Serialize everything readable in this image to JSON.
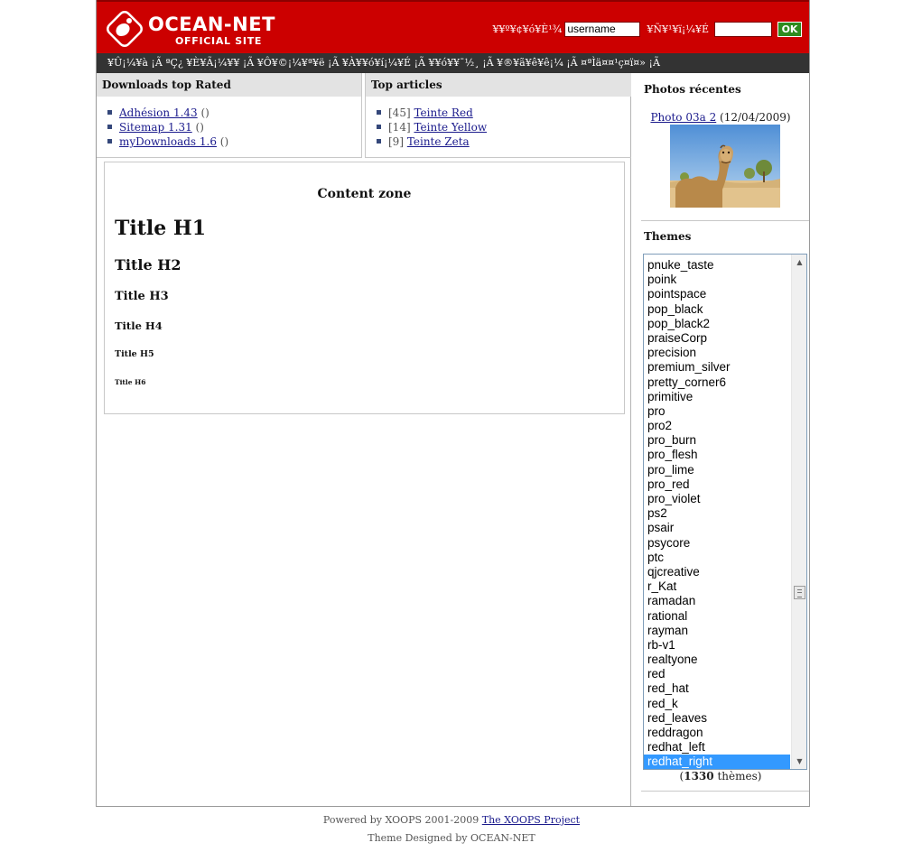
{
  "header": {
    "brand": "OCEAN-NET",
    "subtitle": "OFFICIAL SITE",
    "login": {
      "user_label": "¥¥º¥¢¥ó¥È¹¾",
      "user_value": "username",
      "pass_label": "¥Ñ¥¹¥ï¡¼¥É",
      "pass_value": "",
      "ok_label": "OK"
    },
    "colors": {
      "header_bg": "#cc0000",
      "nav_bg": "#333333",
      "ok_bg": "#2e8b1e"
    }
  },
  "nav": {
    "text": "¥Û¡¼¥à ¡Ã ªÇ¿ ¥È¥Ã¡¼¥¥ ¡Ã ¥Ô¥©¡¼¥ª¥ë ¡Ã ¥À¥¥ó¥í¡¼¥É ¡Ã ¥¥ó¥¥¯½¸ ¡Ã ¥®¥ã¥ê¥ê¡¼ ¡Ã ¤ªÌä¤¤¹ç¤ï¤» ¡Ã"
  },
  "downloads_block": {
    "title": "Downloads top Rated",
    "items": [
      {
        "label": "Adhésion 1.43",
        "suffix": " ()"
      },
      {
        "label": "Sitemap 1.31",
        "suffix": " ()"
      },
      {
        "label": "myDownloads 1.6",
        "suffix": " ()"
      }
    ]
  },
  "articles_block": {
    "title": "Top articles",
    "items": [
      {
        "prefix": "[45] ",
        "label": "Teinte Red"
      },
      {
        "prefix": "[14] ",
        "label": "Teinte Yellow"
      },
      {
        "prefix": "[9] ",
        "label": "Teinte Zeta"
      }
    ]
  },
  "content": {
    "zone_title": "Content zone",
    "h1": "Title H1",
    "h2": "Title H2",
    "h3": "Title H3",
    "h4": "Title H4",
    "h5": "Title H5",
    "h6": "Title H6"
  },
  "photos": {
    "title": "Photos récentes",
    "link": "Photo 03a 2",
    "date": " (12/04/2009)",
    "image_subject": "camel-photo"
  },
  "themes": {
    "title": "Themes",
    "options": [
      "pnuke_taste",
      "poink",
      "pointspace",
      "pop_black",
      "pop_black2",
      "praiseCorp",
      "precision",
      "premium_silver",
      "pretty_corner6",
      "primitive",
      "pro",
      "pro2",
      "pro_burn",
      "pro_flesh",
      "pro_lime",
      "pro_red",
      "pro_violet",
      "ps2",
      "psair",
      "psycore",
      "ptc",
      "qjcreative",
      "r_Kat",
      "ramadan",
      "rational",
      "rayman",
      "rb-v1",
      "realtyone",
      "red",
      "red_hat",
      "red_k",
      "red_leaves",
      "reddragon",
      "redhat_left",
      "redhat_right"
    ],
    "selected": "redhat_right",
    "count_number": "1330",
    "count_label": " thèmes)",
    "count_open": "("
  },
  "footer": {
    "powered": "Powered by XOOPS 2001-2009 ",
    "project_link": "The XOOPS Project",
    "designed": "Theme Designed by OCEAN-NET"
  }
}
